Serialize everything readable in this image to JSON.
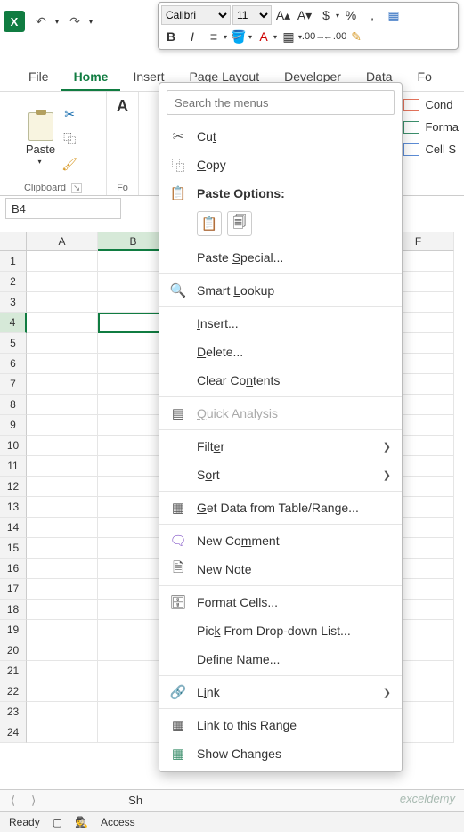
{
  "qat": {
    "undo": "↶",
    "redo": "↷"
  },
  "mini": {
    "font": "Calibri",
    "size": "11",
    "bold": "B",
    "italic": "I"
  },
  "tabs": [
    "File",
    "Home",
    "Insert",
    "Page Layout",
    "Developer",
    "Data",
    "Fo"
  ],
  "active_tab": "Home",
  "ribbon": {
    "paste": "Paste",
    "clipboard": "Clipboard",
    "fo": "Fo"
  },
  "styles": {
    "cond": "Cond",
    "format": "Forma",
    "cell": "Cell S"
  },
  "namebox": "B4",
  "cols": [
    "A",
    "B",
    "F"
  ],
  "rows": [
    "1",
    "2",
    "3",
    "4",
    "5",
    "6",
    "7",
    "8",
    "9",
    "10",
    "11",
    "12",
    "13",
    "14",
    "15",
    "16",
    "17",
    "18",
    "19",
    "20",
    "21",
    "22",
    "23",
    "24"
  ],
  "active_row": "4",
  "active_col": "B",
  "ctx": {
    "search_ph": "Search the menus",
    "cut": "Cut",
    "copy": "Copy",
    "paste_head": "Paste Options:",
    "paste_special": "Paste Special...",
    "smart_lookup": "Smart Lookup",
    "insert": "Insert...",
    "delete": "Delete...",
    "clear": "Clear Contents",
    "quick": "Quick Analysis",
    "filter": "Filter",
    "sort": "Sort",
    "get_data": "Get Data from Table/Range...",
    "new_comment": "New Comment",
    "new_note": "New Note",
    "format_cells": "Format Cells...",
    "pick": "Pick From Drop-down List...",
    "define": "Define Name...",
    "link": "Link",
    "link_range": "Link to this Range",
    "show_changes": "Show Changes"
  },
  "sheet": {
    "label": "Sh"
  },
  "status": {
    "ready": "Ready",
    "access": "Access"
  },
  "watermark": "exceldemy"
}
